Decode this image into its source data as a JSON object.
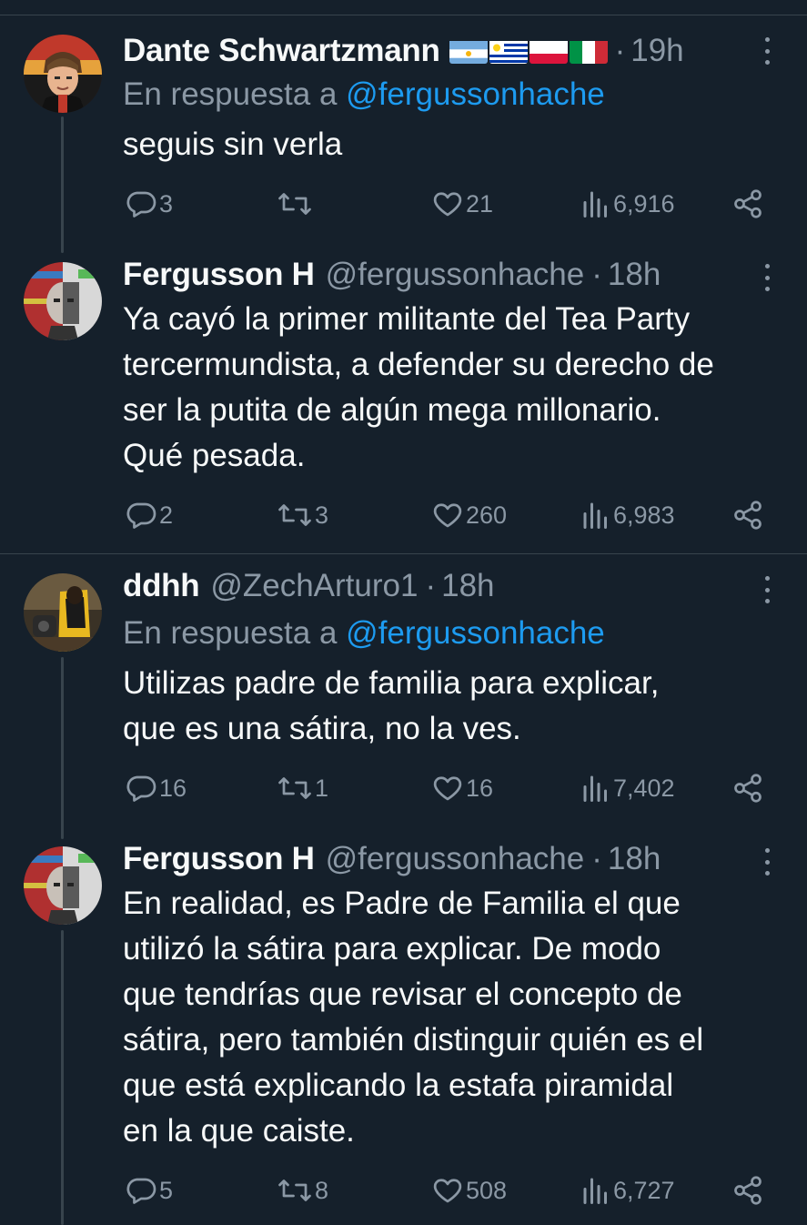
{
  "tweets": [
    {
      "name": "Dante Schwartzmann",
      "handle": "",
      "time": "19h",
      "flags": [
        "argentina-flag",
        "uruguay-flag",
        "poland-flag",
        "italy-flag"
      ],
      "reply_prefix": "En respuesta a",
      "reply_mention": "@fergussonhache",
      "text": "seguis sin verla",
      "replies": "3",
      "retweets": "",
      "likes": "21",
      "views": "6,916"
    },
    {
      "name": "Fergusson H",
      "handle": "@fergussonhache",
      "time": "18h",
      "text_lines": [
        "Ya cayó la primer militante del Tea Party",
        "tercermundista, a defender su derecho de",
        "ser la putita de algún mega millonario.",
        "Qué pesada."
      ],
      "replies": "2",
      "retweets": "3",
      "likes": "260",
      "views": "6,983"
    },
    {
      "name": "ddhh",
      "handle": "@ZechArturo1",
      "time": "18h",
      "reply_prefix": "En respuesta a",
      "reply_mention": "@fergussonhache",
      "text_lines": [
        "Utilizas padre de familia para explicar,",
        "que es una sátira, no la ves."
      ],
      "replies": "16",
      "retweets": "1",
      "likes": "16",
      "views": "7,402"
    },
    {
      "name": "Fergusson H",
      "handle": "@fergussonhache",
      "time": "18h",
      "text_lines": [
        "En realidad, es Padre de Familia el que",
        "utilizó la sátira para explicar. De modo",
        "que tendrías que revisar el concepto de",
        "sátira, pero también distinguir quién es el",
        "que está explicando la estafa piramidal",
        "en la que caiste."
      ],
      "replies": "5",
      "retweets": "8",
      "likes": "508",
      "views": "6,727"
    }
  ],
  "separator": "·",
  "colors": {
    "background": "#15202b",
    "text": "#f7f9f9",
    "secondary": "#8b98a5",
    "link": "#1d9bf0",
    "divider": "#38444d"
  }
}
